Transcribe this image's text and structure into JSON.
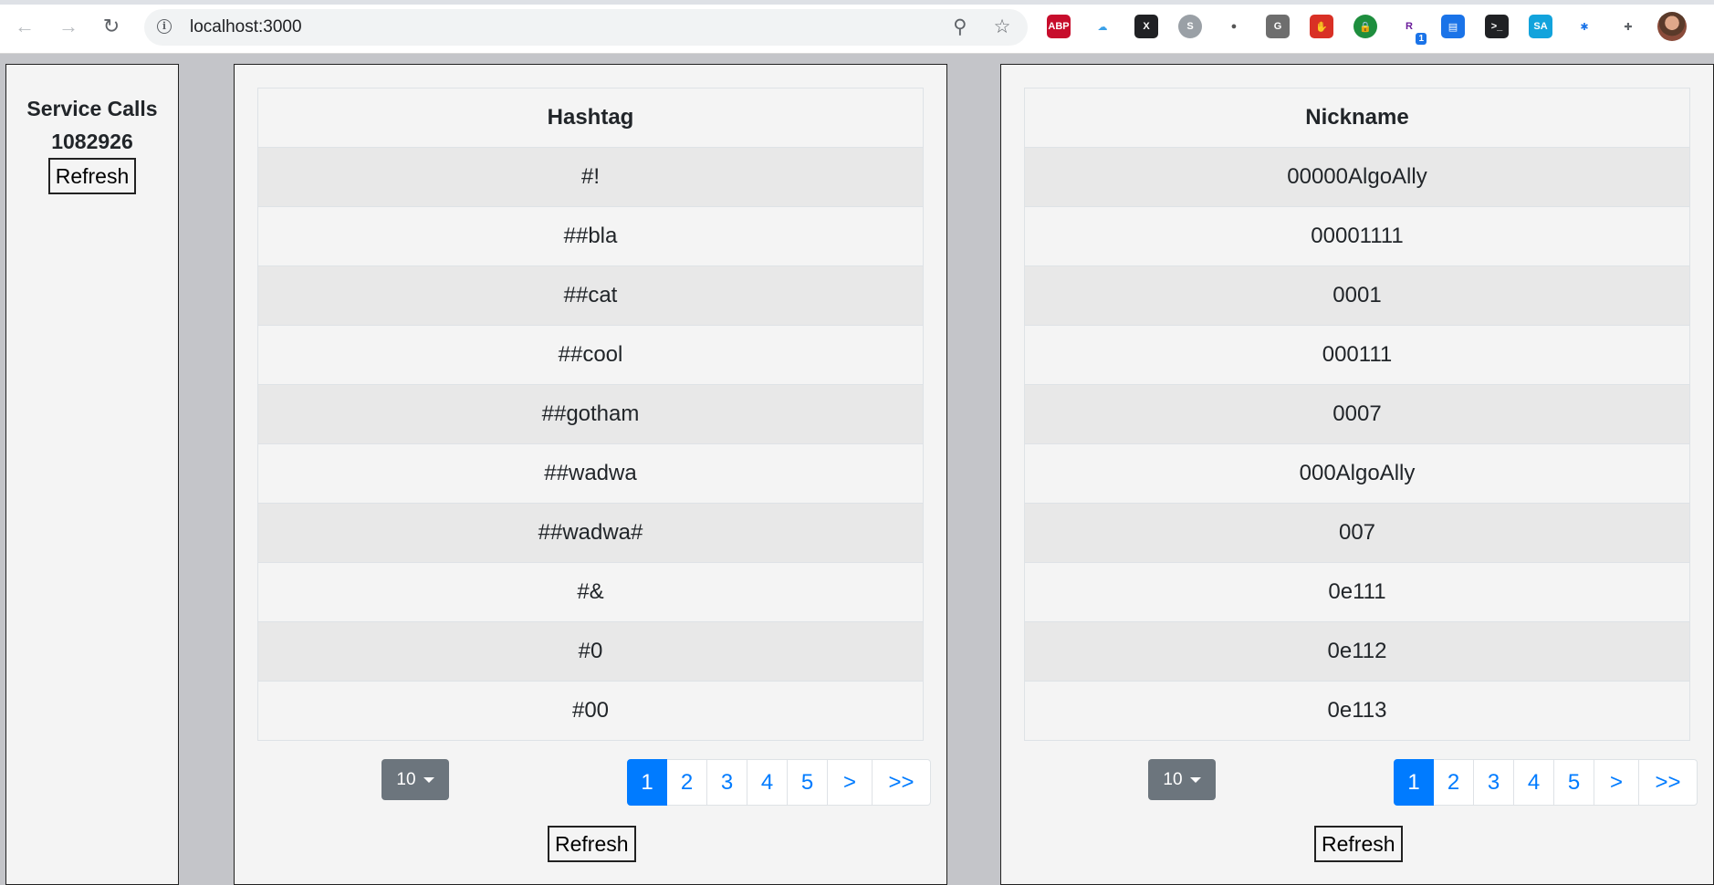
{
  "browser": {
    "url": "localhost:3000",
    "extensions": [
      {
        "name": "adblock-plus-icon",
        "label": "ABP",
        "color": "#c70d2c"
      },
      {
        "name": "cloud-icon",
        "label": "☁",
        "color": "#ffffff"
      },
      {
        "name": "x-extension-icon",
        "label": "X",
        "color": "#202124"
      },
      {
        "name": "s-extension-icon",
        "label": "S",
        "color": "#9aa0a6"
      },
      {
        "name": "circle-extension-icon",
        "label": "●",
        "color": "#6e6e6e"
      },
      {
        "name": "g-extension-icon",
        "label": "G",
        "color": "#6e6e6e"
      },
      {
        "name": "hand-stop-icon",
        "label": "✋",
        "color": "#d93025"
      },
      {
        "name": "lock-extension-icon",
        "label": "🔒",
        "color": "#1e8e3e"
      },
      {
        "name": "r-extension-icon",
        "label": "R",
        "color": "#ffffff",
        "badge": "1"
      },
      {
        "name": "printer-extension-icon",
        "label": "▤",
        "color": "#1a73e8"
      },
      {
        "name": "terminal-icon",
        "label": ">_",
        "color": "#202124"
      },
      {
        "name": "saml-icon",
        "label": "SA",
        "color": "#12a3dc"
      },
      {
        "name": "compass-extension-icon",
        "label": "✱",
        "color": "#ffffff"
      },
      {
        "name": "puzzle-icon",
        "label": "✚",
        "color": "#ffffff"
      }
    ]
  },
  "sidebar": {
    "title": "Service Calls",
    "count": "1082926",
    "refresh_label": "Refresh"
  },
  "hashtags": {
    "header": "Hashtag",
    "rows": [
      "#!",
      "##bla",
      "##cat",
      "##cool",
      "##gotham",
      "##wadwa",
      "##wadwa#",
      "#&",
      "#0",
      "#00"
    ],
    "page_size": "10",
    "pages": [
      "1",
      "2",
      "3",
      "4",
      "5",
      ">",
      ">>"
    ],
    "active_page": "1",
    "refresh_label": "Refresh"
  },
  "nicknames": {
    "header": "Nickname",
    "rows": [
      "00000AlgoAlly",
      "00001111",
      "0001",
      "000111",
      "0007",
      "000AlgoAlly",
      "007",
      "0e111",
      "0e112",
      "0e113"
    ],
    "page_size": "10",
    "pages": [
      "1",
      "2",
      "3",
      "4",
      "5",
      ">",
      ">>"
    ],
    "active_page": "1",
    "refresh_label": "Refresh"
  }
}
